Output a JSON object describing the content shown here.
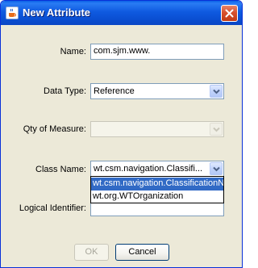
{
  "window": {
    "title": "New Attribute",
    "app_icon": "java-cup-icon",
    "close_icon": "close-icon"
  },
  "form": {
    "name": {
      "label": "Name:",
      "value": "com.sjm.www."
    },
    "data_type": {
      "label": "Data Type:",
      "value": "Reference"
    },
    "qty_of_measure": {
      "label": "Qty of Measure:",
      "value": ""
    },
    "class_name": {
      "label": "Class Name:",
      "value": "wt.csm.navigation.Classifi...",
      "options": [
        "wt.csm.navigation.ClassificationNode",
        "wt.org.WTOrganization"
      ],
      "selected_index": 0
    },
    "logical_identifier": {
      "label": "Logical Identifier:",
      "value": ""
    }
  },
  "buttons": {
    "ok": "OK",
    "cancel": "Cancel"
  },
  "colors": {
    "titlebar": "#0a5fe6",
    "selection": "#316ac5",
    "dialog_bg": "#ece9d8"
  }
}
